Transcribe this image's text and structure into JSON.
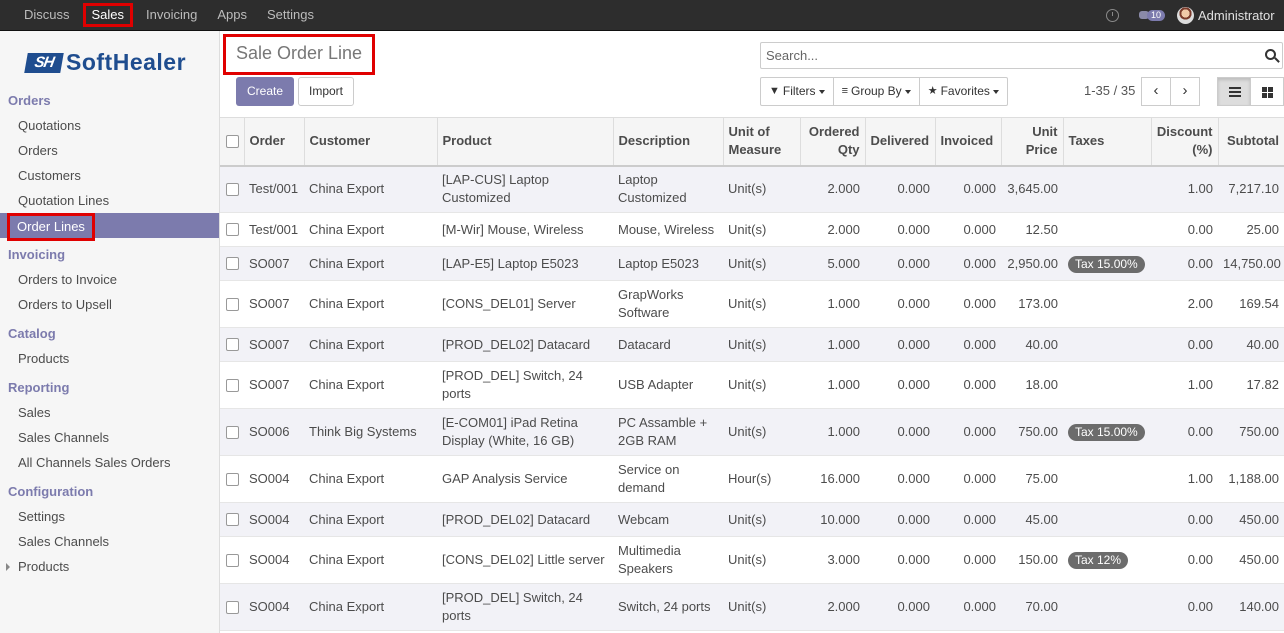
{
  "topbar": {
    "nav": [
      "Discuss",
      "Sales",
      "Invoicing",
      "Apps",
      "Settings"
    ],
    "active": "Sales",
    "messages_count": "10",
    "user": "Administrator"
  },
  "sidebar": {
    "logo": {
      "mark": "SH",
      "text": "SoftHealer"
    },
    "sections": [
      {
        "title": "Orders",
        "items": [
          "Quotations",
          "Orders",
          "Customers",
          "Quotation Lines",
          "Order Lines"
        ]
      },
      {
        "title": "Invoicing",
        "items": [
          "Orders to Invoice",
          "Orders to Upsell"
        ]
      },
      {
        "title": "Catalog",
        "items": [
          "Products"
        ]
      },
      {
        "title": "Reporting",
        "items": [
          "Sales",
          "Sales Channels",
          "All Channels Sales Orders"
        ]
      },
      {
        "title": "Configuration",
        "items": [
          "Settings",
          "Sales Channels",
          "Products"
        ]
      }
    ],
    "active_item": "Order Lines"
  },
  "control": {
    "title": "Sale Order Line",
    "create_label": "Create",
    "import_label": "Import",
    "search_placeholder": "Search...",
    "filters_label": "Filters",
    "groupby_label": "Group By",
    "favorites_label": "Favorites",
    "pager": "1-35 / 35"
  },
  "table": {
    "headers": [
      "Order",
      "Customer",
      "Product",
      "Description",
      "Unit of Measure",
      "Ordered Qty",
      "Delivered",
      "Invoiced",
      "Unit Price",
      "Taxes",
      "Discount (%)",
      "Subtotal"
    ],
    "rows": [
      [
        "Test/001",
        "China Export",
        "[LAP-CUS] Laptop Customized",
        "Laptop Customized",
        "Unit(s)",
        "2.000",
        "0.000",
        "0.000",
        "3,645.00",
        "",
        "1.00",
        "7,217.10"
      ],
      [
        "Test/001",
        "China Export",
        "[M-Wir] Mouse, Wireless",
        "Mouse, Wireless",
        "Unit(s)",
        "2.000",
        "0.000",
        "0.000",
        "12.50",
        "",
        "0.00",
        "25.00"
      ],
      [
        "SO007",
        "China Export",
        "[LAP-E5] Laptop E5023",
        "Laptop E5023",
        "Unit(s)",
        "5.000",
        "0.000",
        "0.000",
        "2,950.00",
        "Tax 15.00%",
        "0.00",
        "14,750.00"
      ],
      [
        "SO007",
        "China Export",
        "[CONS_DEL01] Server",
        "GrapWorks Software",
        "Unit(s)",
        "1.000",
        "0.000",
        "0.000",
        "173.00",
        "",
        "2.00",
        "169.54"
      ],
      [
        "SO007",
        "China Export",
        "[PROD_DEL02] Datacard",
        "Datacard",
        "Unit(s)",
        "1.000",
        "0.000",
        "0.000",
        "40.00",
        "",
        "0.00",
        "40.00"
      ],
      [
        "SO007",
        "China Export",
        "[PROD_DEL] Switch, 24 ports",
        "USB Adapter",
        "Unit(s)",
        "1.000",
        "0.000",
        "0.000",
        "18.00",
        "",
        "1.00",
        "17.82"
      ],
      [
        "SO006",
        "Think Big Systems",
        "[E-COM01] iPad Retina Display (White, 16 GB)",
        "PC Assamble + 2GB RAM",
        "Unit(s)",
        "1.000",
        "0.000",
        "0.000",
        "750.00",
        "Tax 15.00%",
        "0.00",
        "750.00"
      ],
      [
        "SO004",
        "China Export",
        "GAP Analysis Service",
        "Service on demand",
        "Hour(s)",
        "16.000",
        "0.000",
        "0.000",
        "75.00",
        "",
        "1.00",
        "1,188.00"
      ],
      [
        "SO004",
        "China Export",
        "[PROD_DEL02] Datacard",
        "Webcam",
        "Unit(s)",
        "10.000",
        "0.000",
        "0.000",
        "45.00",
        "",
        "0.00",
        "450.00"
      ],
      [
        "SO004",
        "China Export",
        "[CONS_DEL02] Little server",
        "Multimedia Speakers",
        "Unit(s)",
        "3.000",
        "0.000",
        "0.000",
        "150.00",
        "Tax 12%",
        "0.00",
        "450.00"
      ],
      [
        "SO004",
        "China Export",
        "[PROD_DEL] Switch, 24 ports",
        "Switch, 24 ports",
        "Unit(s)",
        "2.000",
        "0.000",
        "0.000",
        "70.00",
        "",
        "0.00",
        "140.00"
      ]
    ]
  },
  "colors": {
    "accent": "#7c7bad",
    "highlight": "#e00000",
    "topbar": "#2d2d2d"
  }
}
